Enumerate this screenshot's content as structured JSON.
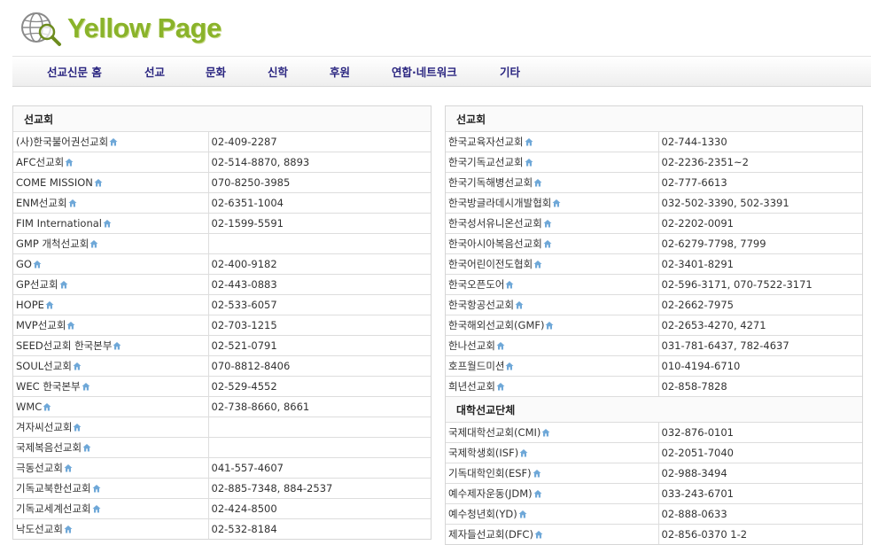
{
  "logo": {
    "text": "Yellow Page",
    "icon": "globe-magnifier-icon"
  },
  "nav": [
    "선교신문 홈",
    "선교",
    "문화",
    "신학",
    "후원",
    "연합·네트워크",
    "기타"
  ],
  "left_panel": [
    {
      "type": "section",
      "title": "선교회"
    },
    {
      "name": "(사)한국불어권선교회",
      "phone": "02-409-2287"
    },
    {
      "name": "AFC선교회",
      "phone": "02-514-8870, 8893"
    },
    {
      "name": "COME MISSION",
      "phone": "070-8250-3985"
    },
    {
      "name": "ENM선교회",
      "phone": "02-6351-1004"
    },
    {
      "name": "FIM International",
      "phone": "02-1599-5591"
    },
    {
      "name": "GMP 개척선교회",
      "phone": ""
    },
    {
      "name": "GO",
      "phone": "02-400-9182"
    },
    {
      "name": "GP선교회",
      "phone": "02-443-0883"
    },
    {
      "name": "HOPE",
      "phone": "02-533-6057"
    },
    {
      "name": "MVP선교회",
      "phone": "02-703-1215"
    },
    {
      "name": "SEED선교회 한국본부",
      "phone": "02-521-0791"
    },
    {
      "name": "SOUL선교회",
      "phone": "070-8812-8406"
    },
    {
      "name": "WEC 한국본부",
      "phone": "02-529-4552"
    },
    {
      "name": "WMC",
      "phone": "02-738-8660, 8661"
    },
    {
      "name": "겨자씨선교회",
      "phone": ""
    },
    {
      "name": "국제복음선교회",
      "phone": ""
    },
    {
      "name": "극동선교회",
      "phone": "041-557-4607"
    },
    {
      "name": "기독교북한선교회",
      "phone": "02-885-7348, 884-2537"
    },
    {
      "name": "기독교세계선교회",
      "phone": "02-424-8500"
    },
    {
      "name": "낙도선교회",
      "phone": "02-532-8184"
    }
  ],
  "right_panel": [
    {
      "type": "section",
      "title": "선교회"
    },
    {
      "name": "한국교육자선교회",
      "phone": "02-744-1330"
    },
    {
      "name": "한국기독교선교회",
      "phone": "02-2236-2351~2"
    },
    {
      "name": "한국기독해병선교회",
      "phone": "02-777-6613"
    },
    {
      "name": "한국방글라데시개발협회",
      "phone": "032-502-3390, 502-3391"
    },
    {
      "name": "한국성서유니온선교회",
      "phone": "02-2202-0091"
    },
    {
      "name": "한국아시아복음선교회",
      "phone": "02-6279-7798, 7799"
    },
    {
      "name": "한국어린이전도협회",
      "phone": "02-3401-8291"
    },
    {
      "name": "한국오픈도어",
      "phone": "02-596-3171, 070-7522-3171"
    },
    {
      "name": "한국항공선교회",
      "phone": "02-2662-7975"
    },
    {
      "name": "한국해외선교회(GMF)",
      "phone": "02-2653-4270, 4271"
    },
    {
      "name": "한나선교회",
      "phone": "031-781-6437, 782-4637"
    },
    {
      "name": "호프월드미션",
      "phone": "010-4194-6710"
    },
    {
      "name": "희년선교회",
      "phone": "02-858-7828"
    },
    {
      "type": "section",
      "title": "대학선교단체"
    },
    {
      "name": "국제대학선교회(CMI)",
      "phone": "032-876-0101"
    },
    {
      "name": "국제학생회(ISF)",
      "phone": "02-2051-7040"
    },
    {
      "name": "기독대학인회(ESF)",
      "phone": "02-988-3494"
    },
    {
      "name": "예수제자운동(JDM)",
      "phone": "033-243-6701"
    },
    {
      "name": "예수청년회(YD)",
      "phone": "02-888-0633"
    },
    {
      "name": "제자들선교회(DFC)",
      "phone": "02-856-0370 1-2"
    }
  ],
  "colors": {
    "logo": "#8ab32a",
    "nav_text": "#2a2580",
    "home_icon": "#6fa8d8"
  }
}
